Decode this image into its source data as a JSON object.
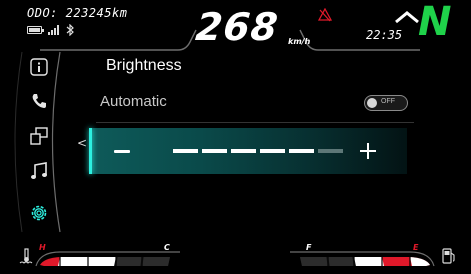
{
  "status_bar": {
    "odometer": "ODO: 223245km",
    "speed": "268",
    "speed_unit": "km/h",
    "time": "22:35",
    "gear": "N",
    "gear_color": "#1fd24a",
    "icons": [
      "battery-icon",
      "signal-icon",
      "bluetooth-icon",
      "warning-icon",
      "shift-up-icon"
    ]
  },
  "sidebar": {
    "items": [
      {
        "name": "info",
        "icon": "info-icon"
      },
      {
        "name": "phone",
        "icon": "phone-icon"
      },
      {
        "name": "windows",
        "icon": "windows-icon"
      },
      {
        "name": "music",
        "icon": "music-icon"
      },
      {
        "name": "settings",
        "icon": "gear-icon",
        "active": true
      }
    ],
    "accent_color": "#2df0e0"
  },
  "content": {
    "title": "Brightness",
    "automatic_label": "Automatic",
    "automatic_toggle_text": "OFF",
    "automatic_on": false,
    "brightness_level": 5,
    "brightness_max": 6,
    "chevron": "<"
  },
  "gauges": {
    "temperature": {
      "high_label": "H",
      "low_label": "C",
      "level_fraction": 0.4
    },
    "fuel": {
      "full_label": "F",
      "empty_label": "E",
      "level_fraction": 0.7
    },
    "warn_color": "#e0192a"
  }
}
